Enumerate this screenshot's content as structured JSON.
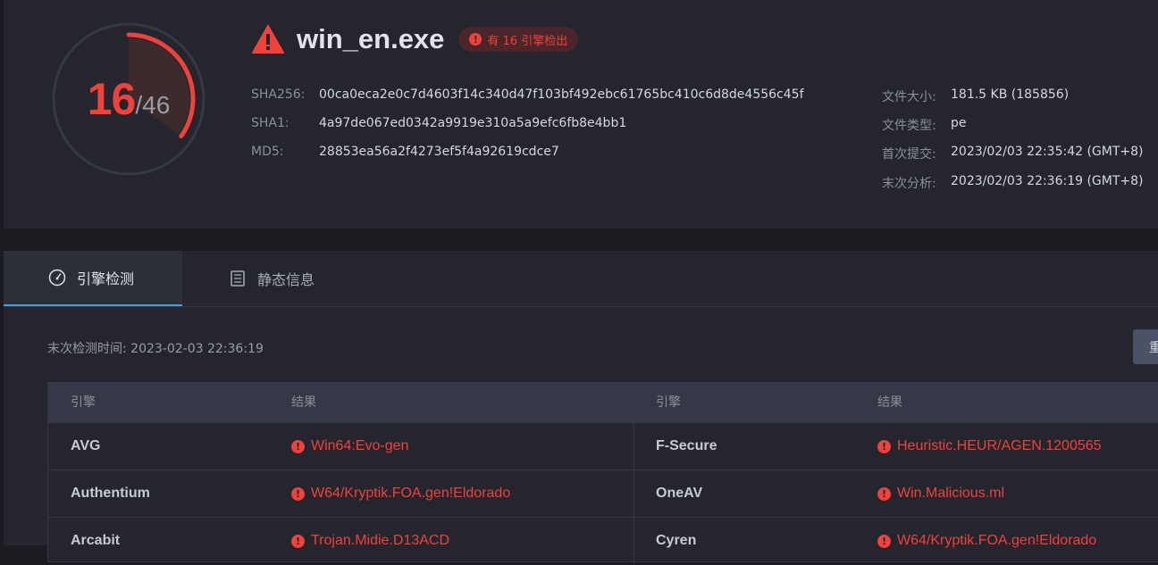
{
  "gauge": {
    "detected": "16",
    "total": "/46",
    "fraction": 0.348
  },
  "file": {
    "name": "win_en.exe",
    "badge": "有 16 引擎检出"
  },
  "hashes": [
    {
      "label": "SHA256:",
      "value": "00ca0eca2e0c7d4603f14c340d47f103bf492ebc61765bc410c6d8de4556c45f"
    },
    {
      "label": "SHA1:",
      "value": "4a97de067ed0342a9919e310a5a9efc6fb8e4bb1"
    },
    {
      "label": "MD5:",
      "value": "28853ea56a2f4273ef5f4a92619cdce7"
    }
  ],
  "meta": [
    {
      "label": "文件大小:",
      "value": "181.5 KB (185856)"
    },
    {
      "label": "文件类型:",
      "value": "pe"
    },
    {
      "label": "首次提交:",
      "value": "2023/02/03 22:35:42 (GMT+8)"
    },
    {
      "label": "末次分析:",
      "value": "2023/02/03 22:36:19 (GMT+8)"
    }
  ],
  "tabs": [
    {
      "label": "引擎检测",
      "icon": "gauge-icon",
      "active": true
    },
    {
      "label": "静态信息",
      "icon": "document-icon",
      "active": false
    }
  ],
  "last_detect": "末次检测时间: 2023-02-03 22:36:19",
  "rescan_label": "重",
  "table": {
    "headers": [
      "引擎",
      "结果",
      "引擎",
      "结果"
    ],
    "rows": [
      {
        "engine1": "AVG",
        "result1": "Win64:Evo-gen",
        "engine2": "F-Secure",
        "result2": "Heuristic.HEUR/AGEN.1200565"
      },
      {
        "engine1": "Authentium",
        "result1": "W64/Kryptik.FOA.gen!Eldorado",
        "engine2": "OneAV",
        "result2": "Win.Malicious.ml"
      },
      {
        "engine1": "Arcabit",
        "result1": "Trojan.Midie.D13ACD",
        "engine2": "Cyren",
        "result2": "W64/Kryptik.FOA.gen!Eldorado"
      }
    ]
  },
  "colors": {
    "alert": "#f0413b",
    "tab_accent": "#3ea3e0"
  }
}
